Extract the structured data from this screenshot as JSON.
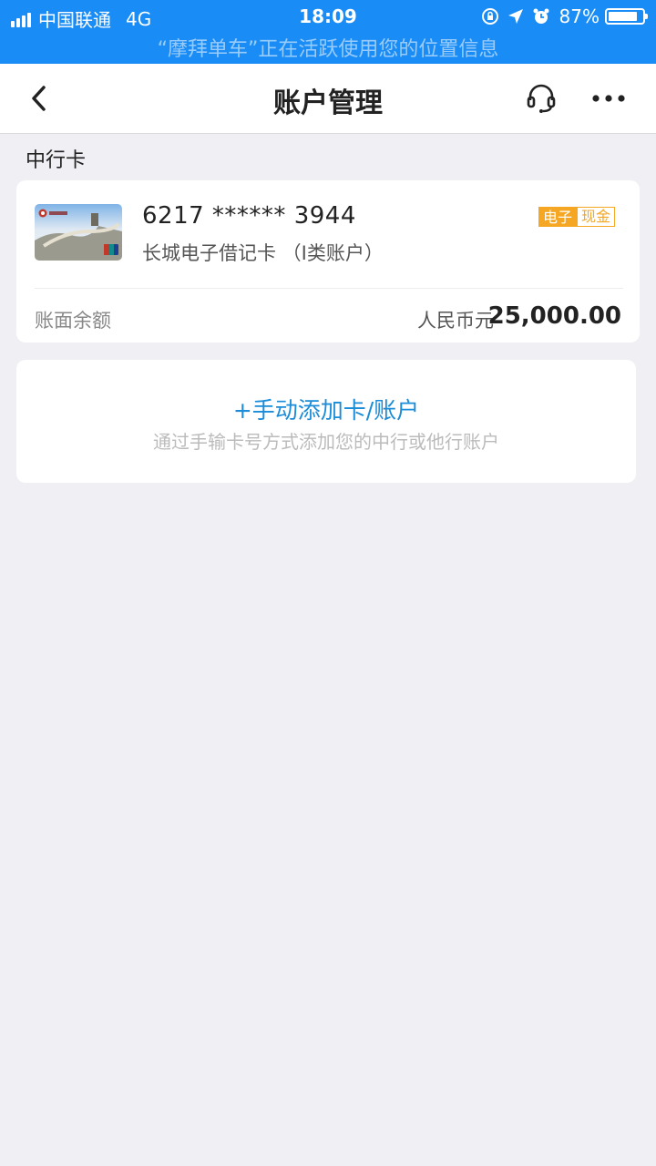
{
  "status_bar": {
    "carrier": "中国联通",
    "network": "4G",
    "time": "18:09",
    "battery": "87%",
    "battery_level": 0.87,
    "location_notice": "“摩拜单车”正在活跃使用您的位置信息"
  },
  "nav": {
    "title": "账户管理",
    "icons": [
      "back-arrow-icon",
      "headset-icon",
      "more-icon"
    ]
  },
  "section": {
    "title": "中行卡"
  },
  "card": {
    "number": "6217 ****** 3944",
    "type": "长城电子借记卡 （I类账户）",
    "tag_left": "电子",
    "tag_right": "现金",
    "balance_label": "账面余额",
    "currency": "人民币元",
    "balance": "25,000.00"
  },
  "add_account": {
    "title": "+手动添加卡/账户",
    "subtitle": "通过手输卡号方式添加您的中行或他行账户"
  },
  "colors": {
    "status_bar_bg": "#1a8cf5",
    "accent": "#1a8cd8",
    "tag": "#f5a623",
    "background": "#efeff4"
  }
}
